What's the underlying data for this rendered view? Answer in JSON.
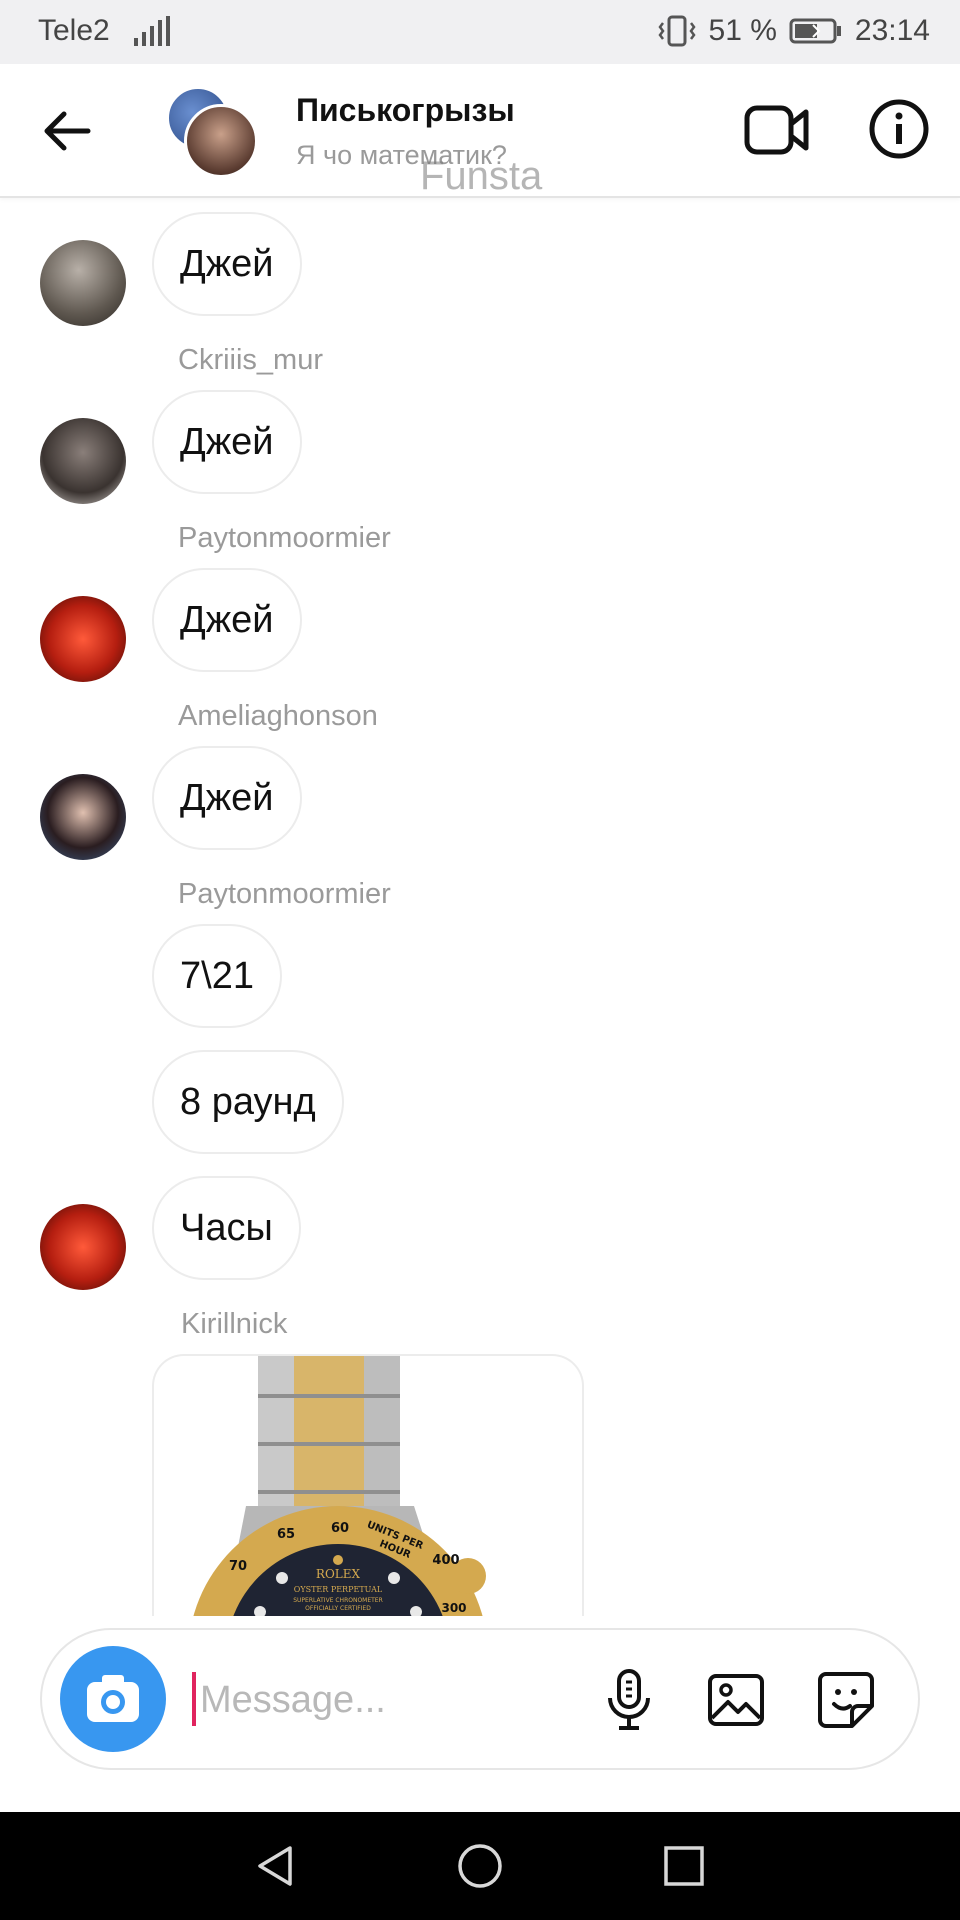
{
  "status_bar": {
    "carrier": "Tele2",
    "battery": "51 %",
    "time": "23:14"
  },
  "header": {
    "title": "Писькогрызы",
    "subtitle": "Я чо математик?",
    "overlay_text": "Funsta",
    "back_icon": "arrow-left-icon",
    "video_icon": "video-camera-icon",
    "info_icon": "info-icon"
  },
  "messages": [
    {
      "text": "Джей",
      "sender": "Ckriiis_mur"
    },
    {
      "text": "Джей",
      "sender": "Paytonmoormier"
    },
    {
      "text": "Джей",
      "sender": "Ameliaghonson"
    },
    {
      "text": "Джей",
      "sender": "Paytonmoormier"
    },
    {
      "text": "7\\21"
    },
    {
      "text": "8 раунд"
    },
    {
      "text": "Часы",
      "sender": "Kirillnick"
    }
  ],
  "image_message": {
    "brand": "ROLEX",
    "line1": "OYSTER PERPETUAL",
    "line2": "SUPERLATIVE CHRONOMETER",
    "line3": "OFFICIALLY CERTIFIED",
    "bezel_60": "60",
    "bezel_65": "65",
    "bezel_70": "70",
    "bezel_400": "400",
    "bezel_300": "300",
    "bezel_units": "UNITS PER",
    "bezel_hour": "HOUR"
  },
  "composer": {
    "placeholder": "Message...",
    "value": ""
  },
  "colors": {
    "accent": "#3897f0",
    "cursor": "#e0245e"
  }
}
